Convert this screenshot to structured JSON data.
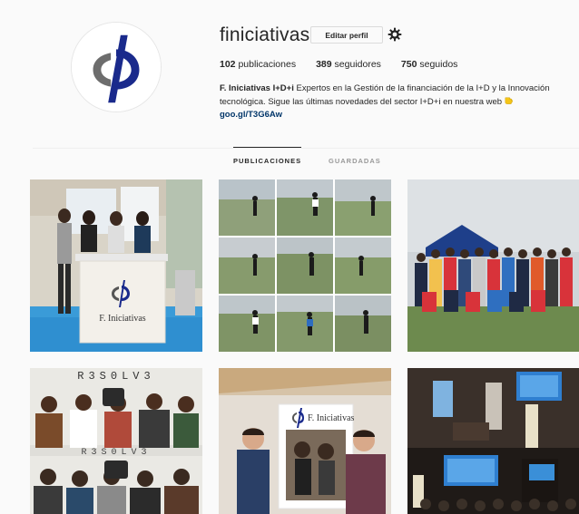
{
  "profile": {
    "username": "finiciativas",
    "edit_button": "Editar perfil",
    "stats": {
      "posts_count": "102",
      "posts_label": "publicaciones",
      "followers_count": "389",
      "followers_label": "seguidores",
      "following_count": "750",
      "following_label": "seguidos"
    },
    "bio": {
      "name": "F. Iniciativas I+D+i",
      "text": "Expertos en la Gestión de la financiación de la I+D y la Innovación tecnológica. Sigue las últimas novedades del sector I+D+i en nuestra web",
      "link": "goo.gl/T3G6Aw"
    },
    "avatar_icon": "phi-logo-icon",
    "brand_color": "#1a2a8c"
  },
  "tabs": [
    {
      "label": "PUBLICACIONES",
      "active": true
    },
    {
      "label": "GUARDADAS",
      "active": false
    }
  ],
  "posts": [
    {
      "name": "post-booth-team",
      "signage": "F. Iniciativas"
    },
    {
      "name": "post-cross-country-collage"
    },
    {
      "name": "post-race-group-photo"
    },
    {
      "name": "post-r3s0lv3-team",
      "signage": "R3S0LV3"
    },
    {
      "name": "post-photo-frame",
      "signage": "F. Iniciativas"
    },
    {
      "name": "post-conference"
    }
  ]
}
